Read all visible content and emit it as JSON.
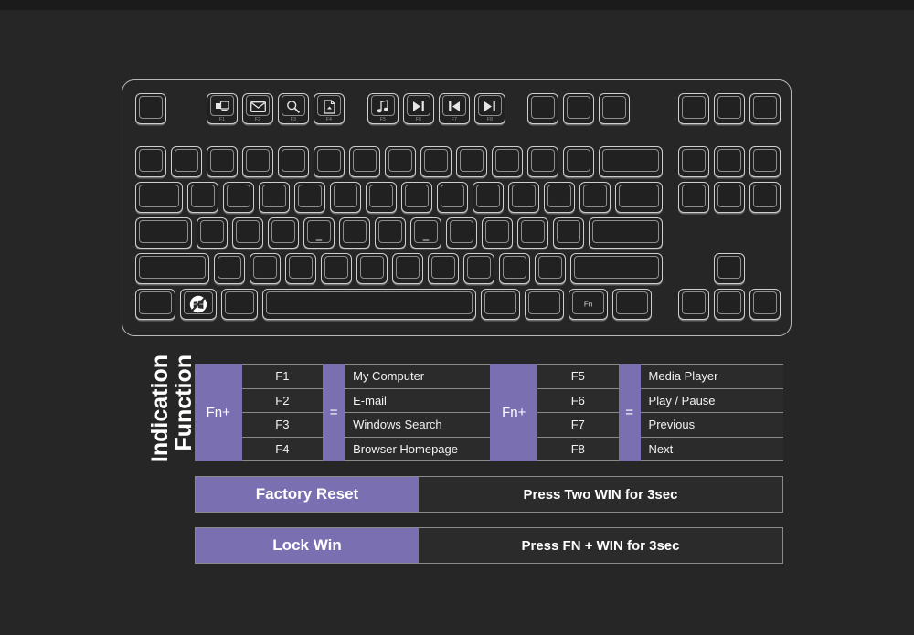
{
  "keyboard": {
    "esc_label": "",
    "function_keys": [
      {
        "label": "F1",
        "icon": "my-computer-icon"
      },
      {
        "label": "F2",
        "icon": "email-icon"
      },
      {
        "label": "F3",
        "icon": "search-icon"
      },
      {
        "label": "F4",
        "icon": "browser-home-icon"
      },
      {
        "label": "F5",
        "icon": "media-player-icon"
      },
      {
        "label": "F6",
        "icon": "play-pause-icon"
      },
      {
        "label": "F7",
        "icon": "previous-track-icon"
      },
      {
        "label": "F8",
        "icon": "next-track-icon"
      }
    ],
    "fn_key_label": "Fn",
    "win_key_icon": "windows-lock-icon"
  },
  "title": {
    "line1": "Function",
    "line2": "Indication"
  },
  "fn_table": {
    "group1": {
      "fn_label": "Fn+",
      "equals": "=",
      "keys": [
        "F1",
        "F2",
        "F3",
        "F4"
      ],
      "descriptions": [
        "My Computer",
        "E-mail",
        "Windows Search",
        "Browser Homepage"
      ]
    },
    "group2": {
      "fn_label": "Fn+",
      "equals": "=",
      "keys": [
        "F5",
        "F6",
        "F7",
        "F8"
      ],
      "descriptions": [
        "Media Player",
        "Play / Pause",
        "Previous",
        "Next"
      ]
    }
  },
  "shortcuts": [
    {
      "label": "Factory Reset",
      "value": "Press Two WIN for 3sec"
    },
    {
      "label": "Lock Win",
      "value": "Press FN + WIN for 3sec"
    }
  ],
  "colors": {
    "accent_purple": "#7a6fb0",
    "background": "#262626",
    "cell_background": "#2b2b2b",
    "text": "#ffffff"
  }
}
